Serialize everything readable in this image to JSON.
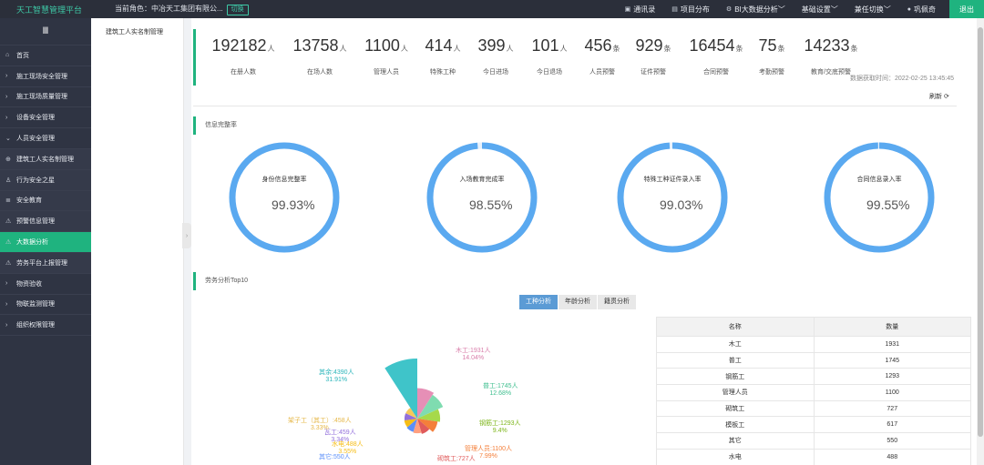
{
  "topbar": {
    "brand": "天工智慧管理平台",
    "role_label": "当前角色：中冶天工集团有限公...",
    "switch_label": "切换",
    "nav": [
      {
        "icon": "▣",
        "label": "通讯录"
      },
      {
        "icon": "▤",
        "label": "项目分布"
      },
      {
        "icon": "⚙",
        "label": "BI大数据分析﹀"
      },
      {
        "icon": "",
        "label": "基础设置﹀"
      },
      {
        "icon": "",
        "label": "兼任切换﹀"
      },
      {
        "icon": "●",
        "label": "巩佩奇"
      }
    ],
    "logout_label": "退出"
  },
  "sidebar": {
    "toggle": "Ⅲ",
    "items": [
      {
        "icon": "⌂",
        "label": "首页"
      },
      {
        "icon": "›",
        "label": "施工现场安全管理"
      },
      {
        "icon": "›",
        "label": "施工现场质量管理"
      },
      {
        "icon": "›",
        "label": "设备安全管理"
      },
      {
        "icon": "⌄",
        "label": "人员安全管理"
      },
      {
        "icon": "⊕",
        "label": "建筑工人实名制管理"
      },
      {
        "icon": "♙",
        "label": "行为安全之星"
      },
      {
        "icon": "≣",
        "label": "安全教育"
      },
      {
        "icon": "⚠",
        "label": "预警信息管理"
      },
      {
        "icon": "⚠",
        "label": "大数据分析"
      },
      {
        "icon": "⚠",
        "label": "劳务平台上报管理"
      },
      {
        "icon": "›",
        "label": "物资验收"
      },
      {
        "icon": "›",
        "label": "物联监测管理"
      },
      {
        "icon": "›",
        "label": "组织权限管理"
      }
    ]
  },
  "tabs": {
    "active": "建筑工人实名制管理"
  },
  "stats": [
    {
      "value": "192182",
      "unit": "人",
      "label": "在册人数"
    },
    {
      "value": "13758",
      "unit": "人",
      "label": "在场人数"
    },
    {
      "value": "1100",
      "unit": "人",
      "label": "管理人员"
    },
    {
      "value": "414",
      "unit": "人",
      "label": "特殊工种"
    },
    {
      "value": "399",
      "unit": "人",
      "label": "今日进场"
    },
    {
      "value": "101",
      "unit": "人",
      "label": "今日退场"
    },
    {
      "value": "456",
      "unit": "条",
      "label": "人员预警"
    },
    {
      "value": "929",
      "unit": "条",
      "label": "证件预警"
    },
    {
      "value": "16454",
      "unit": "条",
      "label": "合同预警"
    },
    {
      "value": "75",
      "unit": "条",
      "label": "考勤预警"
    },
    {
      "value": "14233",
      "unit": "条",
      "label": "教育/交底预警"
    }
  ],
  "timestamp": "数据获取时间：2022-02-25 13:45:45",
  "refresh_label": "刷新 ⟳",
  "sections": {
    "integrity": "信息完整率",
    "labor": "劳务分析Top10"
  },
  "rings": [
    {
      "label": "身份信息完整率",
      "value": "99.93%",
      "ratio": 0.9993
    },
    {
      "label": "入场教育完成率",
      "value": "98.55%",
      "ratio": 0.9855
    },
    {
      "label": "特殊工种证件录入率",
      "value": "99.03%",
      "ratio": 0.9903
    },
    {
      "label": "合同信息录入率",
      "value": "99.55%",
      "ratio": 0.9955
    }
  ],
  "seg_tabs": [
    "工种分析",
    "年龄分析",
    "籍贯分析"
  ],
  "pie": {
    "labels": [
      {
        "text": "木工:1931人\n14.04%",
        "color": "#d97eaa"
      },
      {
        "text": "普工:1745人\n12.68%",
        "color": "#6dd3a6"
      },
      {
        "text": "钢筋工:1293人\n9.4%",
        "color": "#9acd32"
      },
      {
        "text": "管理人员:1100人\n7.99%",
        "color": "#f47f3a"
      },
      {
        "text": "砌筑工:727人",
        "color": "#e05b5b"
      },
      {
        "text": "其它:550人",
        "color": "#5b8ff9"
      },
      {
        "text": "水电:488人\n3.55%",
        "color": "#f6bd16"
      },
      {
        "text": "瓦工:459人\n3.34%",
        "color": "#9370db"
      },
      {
        "text": "架子工（其工）:458人\n3.33%",
        "color": "#f6c95a"
      },
      {
        "text": "其余:4390人\n31.91%",
        "color": "#3fc4c9"
      }
    ],
    "slices": [
      {
        "value": 1931,
        "color": "#e68fb6"
      },
      {
        "value": 1745,
        "color": "#7fdcb0"
      },
      {
        "value": 1293,
        "color": "#a6d94a"
      },
      {
        "value": 1100,
        "color": "#f47f3a"
      },
      {
        "value": 727,
        "color": "#e05b5b"
      },
      {
        "value": 617,
        "color": "#ff9f7f"
      },
      {
        "value": 550,
        "color": "#5b8ff9"
      },
      {
        "value": 488,
        "color": "#f6bd16"
      },
      {
        "value": 459,
        "color": "#9370db"
      },
      {
        "value": 458,
        "color": "#f6c95a"
      },
      {
        "value": 4390,
        "color": "#3fc4c9"
      }
    ]
  },
  "table": {
    "headers": [
      "名称",
      "数量"
    ],
    "rows": [
      [
        "木工",
        "1931"
      ],
      [
        "普工",
        "1745"
      ],
      [
        "钢筋工",
        "1293"
      ],
      [
        "管理人员",
        "1100"
      ],
      [
        "砌筑工",
        "727"
      ],
      [
        "模板工",
        "617"
      ],
      [
        "其它",
        "550"
      ],
      [
        "水电",
        "488"
      ]
    ]
  }
}
